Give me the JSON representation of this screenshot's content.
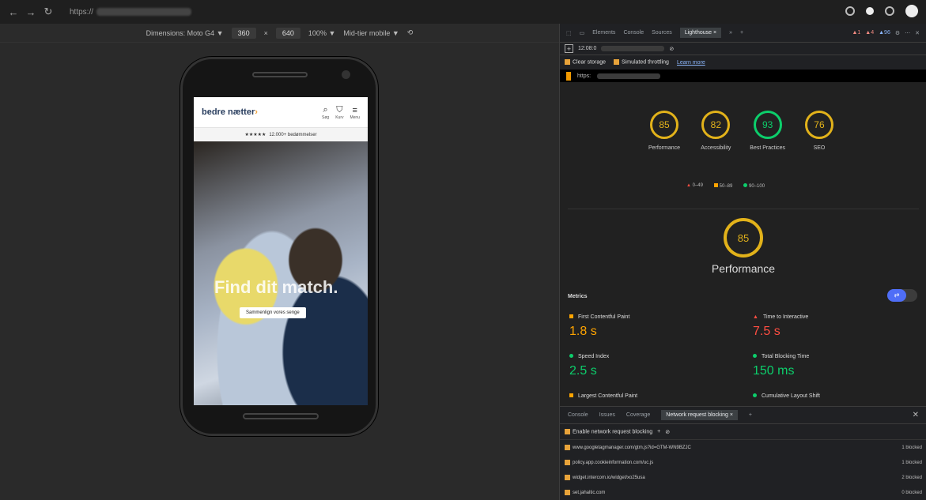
{
  "browser": {
    "back_icon": "←",
    "forward_icon": "→",
    "reload_icon": "↻",
    "url_prefix": "https://"
  },
  "device_toolbar": {
    "dimensions_label": "Dimensions: Moto G4 ▼",
    "width": "360",
    "times": "×",
    "height": "640",
    "zoom": "100% ▼",
    "throttle": "Mid-tier mobile ▼"
  },
  "site": {
    "logo_text": "bedre nætter",
    "nav": [
      {
        "icon": "⌕",
        "label": "Søg"
      },
      {
        "icon": "⛉",
        "label": "Kurv"
      },
      {
        "icon": "≡",
        "label": "Menu"
      }
    ],
    "stars": "★★★★★",
    "review_text": "12.000+ bedømmelser",
    "hero_title": "Find dit match.",
    "hero_button": "Sammenlign vores senge"
  },
  "devtools": {
    "tabs": [
      "Elements",
      "Console",
      "Sources",
      "Lighthouse",
      "»"
    ],
    "active_tab": "Lighthouse",
    "close_tab": "×",
    "add": "+",
    "badge_errors": "▲1",
    "badge_warnings": "▲4",
    "badge_info": "▲96",
    "more": "⋯",
    "close": "✕",
    "report_time": "12:08:0",
    "clear_storage": "Clear storage",
    "simulated_throttling": "Simulated throttling",
    "learn_more": "Learn more",
    "url_prefix": "https:",
    "scores": [
      {
        "value": "85",
        "label": "Performance",
        "color": "#e2b21a"
      },
      {
        "value": "82",
        "label": "Accessibility",
        "color": "#e2b21a"
      },
      {
        "value": "93",
        "label": "Best Practices",
        "color": "#0cce6b"
      },
      {
        "value": "76",
        "label": "SEO",
        "color": "#e2b21a"
      }
    ],
    "legend": {
      "red": "0–49",
      "orange": "50–89",
      "green": "90–100"
    },
    "big_score": {
      "value": "85",
      "label": "Performance"
    },
    "metrics_header": "Metrics",
    "metrics": [
      {
        "name": "First Contentful Paint",
        "value": "1.8 s",
        "status": "orange"
      },
      {
        "name": "Time to Interactive",
        "value": "7.5 s",
        "status": "red"
      },
      {
        "name": "Speed Index",
        "value": "2.5 s",
        "status": "green"
      },
      {
        "name": "Total Blocking Time",
        "value": "150 ms",
        "status": "green"
      },
      {
        "name": "Largest Contentful Paint",
        "value": "",
        "status": "orange"
      },
      {
        "name": "Cumulative Layout Shift",
        "value": "",
        "status": "green"
      }
    ]
  },
  "drawer": {
    "tabs": [
      "Console",
      "Issues",
      "Coverage",
      "Network request blocking"
    ],
    "active_tab": "Network request blocking",
    "enable_label": "Enable network request blocking",
    "blocked": [
      {
        "url": "www.googletagmanager.com/gtm.js?id=GTM-WN9BZJC",
        "count": "1 blocked"
      },
      {
        "url": "policy.app.cookieinformation.com/uc.js",
        "count": "1 blocked"
      },
      {
        "url": "widget.intercom.io/widget/xo25usa",
        "count": "2 blocked"
      },
      {
        "url": "set.jahaltic.com",
        "count": "0 blocked"
      }
    ]
  }
}
